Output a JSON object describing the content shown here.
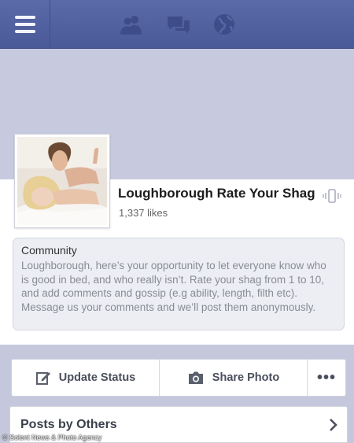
{
  "nav": {
    "icons": [
      "menu-icon",
      "friend-requests-icon",
      "messages-icon",
      "notifications-globe-icon"
    ]
  },
  "page": {
    "name": "Loughborough Rate Your Shag",
    "likes": "1,337 likes",
    "category": "Community",
    "about": "Loughborough, here’s your opportunity to let everyone know who is good in bed, and who really isn’t. Rate your shag from 1 to 10, and add comments and gossip (e.g ability, length, filth etc). Message us your comments and we’ll post them anonymously."
  },
  "actions": {
    "update_status": "Update Status",
    "share_photo": "Share Photo",
    "more": "•••"
  },
  "posts_by_others": "Posts by Others",
  "watermark": "© Solent News & Photo Agency",
  "colors": {
    "topbar": "#4f5f9f",
    "background": "#c5c8dc",
    "card": "#ffffff"
  }
}
